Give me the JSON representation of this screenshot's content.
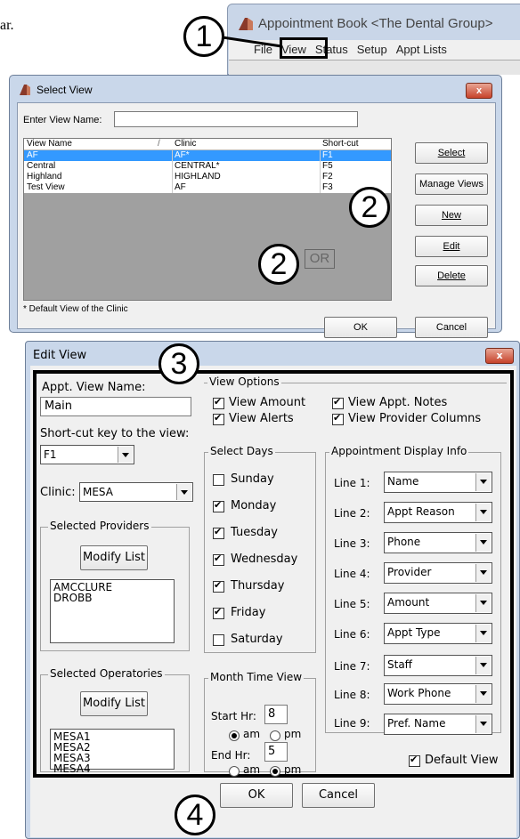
{
  "page_fragment": "ar.",
  "bg_window": {
    "title": "Appointment Book <The Dental Group>",
    "menu": [
      "File",
      "View",
      "Status",
      "Setup",
      "Appt Lists"
    ]
  },
  "select_view": {
    "title": "Select View",
    "close": "x",
    "enter_label": "Enter View Name:",
    "enter_value": "",
    "columns": [
      "View Name",
      "Clinic",
      "Short-cut"
    ],
    "rows": [
      {
        "name": "AF",
        "clinic": "AF*",
        "shortcut": "F1"
      },
      {
        "name": "Central",
        "clinic": "CENTRAL*",
        "shortcut": "F5"
      },
      {
        "name": "Highland",
        "clinic": "HIGHLAND",
        "shortcut": "F2"
      },
      {
        "name": "Test View",
        "clinic": "AF",
        "shortcut": "F3"
      }
    ],
    "buttons": {
      "select": "Select",
      "manage": "Manage Views",
      "new": "New",
      "edit": "Edit",
      "delete": "Delete",
      "ok": "OK",
      "cancel": "Cancel"
    },
    "footnote": "* Default View of the Clinic",
    "or_label": "OR"
  },
  "edit_view": {
    "title": "Edit View",
    "close": "x",
    "appt_view_name_label": "Appt. View Name:",
    "appt_view_name": "Main",
    "shortcut_label": "Short-cut key to the view:",
    "shortcut": "F1",
    "clinic_label": "Clinic:",
    "clinic": "MESA",
    "providers_group": "Selected Providers",
    "modify_list": "Modify List",
    "providers": [
      "AMCCLURE",
      "DROBB"
    ],
    "operatories_group": "Selected Operatories",
    "operatories": [
      "MESA1",
      "MESA2",
      "MESA3",
      "MESA4"
    ],
    "view_options_group": "View Options",
    "view_options": [
      {
        "label": "View Amount",
        "checked": true
      },
      {
        "label": "View Alerts",
        "checked": true
      },
      {
        "label": "View Appt. Notes",
        "checked": true
      },
      {
        "label": "View Provider Columns",
        "checked": true
      }
    ],
    "select_days_group": "Select Days",
    "days": [
      {
        "label": "Sunday",
        "checked": false
      },
      {
        "label": "Monday",
        "checked": true
      },
      {
        "label": "Tuesday",
        "checked": true
      },
      {
        "label": "Wednesday",
        "checked": true
      },
      {
        "label": "Thursday",
        "checked": true
      },
      {
        "label": "Friday",
        "checked": true
      },
      {
        "label": "Saturday",
        "checked": false
      }
    ],
    "month_group": "Month Time View",
    "start_label": "Start Hr:",
    "start_hr": "8",
    "end_label": "End Hr:",
    "end_hr": "5",
    "am": "am",
    "pm": "pm",
    "display_group": "Appointment Display Info",
    "lines": [
      {
        "label": "Line 1:",
        "value": "Name"
      },
      {
        "label": "Line 2:",
        "value": "Appt Reason"
      },
      {
        "label": "Line 3:",
        "value": "Phone"
      },
      {
        "label": "Line 4:",
        "value": "Provider"
      },
      {
        "label": "Line 5:",
        "value": "Amount"
      },
      {
        "label": "Line 6:",
        "value": "Appt Type"
      },
      {
        "label": "Line 7:",
        "value": "Staff"
      },
      {
        "label": "Line 8:",
        "value": "Work Phone"
      },
      {
        "label": "Line 9:",
        "value": "Pref. Name"
      }
    ],
    "default_view": "Default View",
    "ok": "OK",
    "cancel": "Cancel"
  },
  "callouts": [
    "1",
    "2",
    "2",
    "3",
    "4"
  ]
}
